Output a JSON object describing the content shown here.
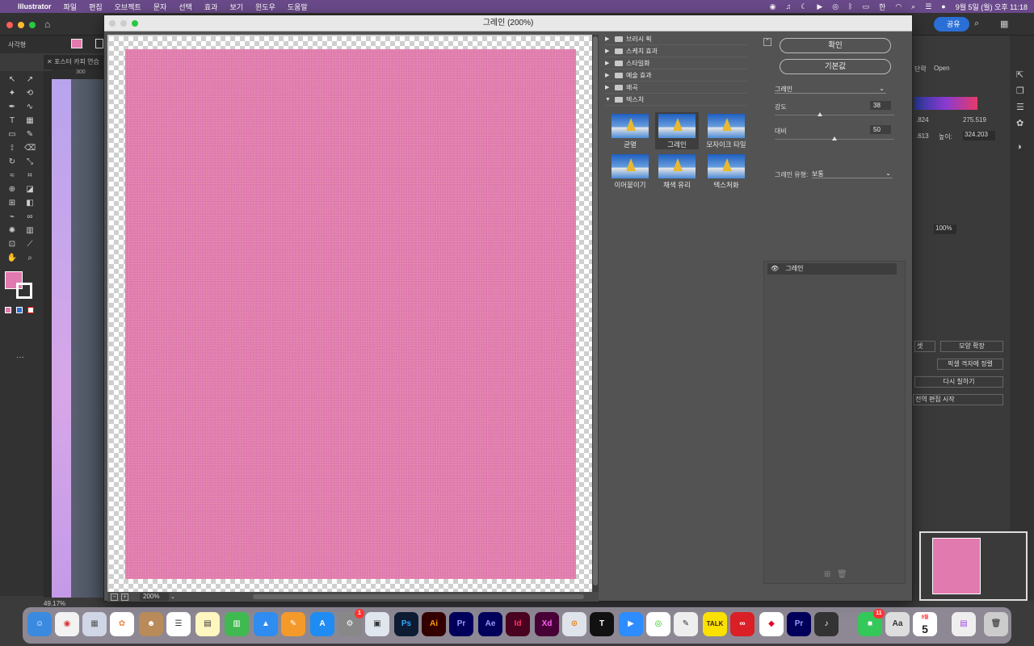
{
  "menubar": {
    "app": "Illustrator",
    "items": [
      "파일",
      "편집",
      "오브젝트",
      "문자",
      "선택",
      "효과",
      "보기",
      "윈도우",
      "도움말"
    ],
    "share": "공유",
    "clock": "9월 5일 (월) 오후 11:18"
  },
  "app": {
    "control_label": "사각형",
    "doc_tab": "포스터 카피 연습",
    "ruler_mark": "300",
    "zoom_status": "49.17%",
    "right_panel": {
      "tab_label_1": "단락",
      "tab_label_2": "Open",
      "w_value": ".824",
      "x_value": "275.519",
      "h_label": "높이:",
      "h_value": "324.203",
      "y_value": ".613",
      "percent": "100%",
      "btn_expand": "모양 확장",
      "btn_pixel": "픽셀 격자에 정렬",
      "btn_redraw": "다시 칠하기",
      "btn_edit": "전역 편집 시작",
      "btn_set": "셋"
    }
  },
  "dialog": {
    "title": "그레인 (200%)",
    "zoom": "200%",
    "categories": [
      {
        "label": "브러시 획",
        "open": false
      },
      {
        "label": "스케치 효과",
        "open": false
      },
      {
        "label": "스타일화",
        "open": false
      },
      {
        "label": "예술 효과",
        "open": false
      },
      {
        "label": "왜곡",
        "open": false
      },
      {
        "label": "텍스처",
        "open": true
      }
    ],
    "thumbnails": [
      "균열",
      "그레인",
      "모자이크 타일",
      "이어붙이기",
      "채색 유리",
      "텍스처화"
    ],
    "selected_thumbnail": "그레인",
    "ok": "확인",
    "default": "기본값",
    "effect_select": "그레인",
    "intensity_label": "강도",
    "intensity_value": "38",
    "intensity_level": 38,
    "contrast_label": "대비",
    "contrast_value": "50",
    "contrast_level": 50,
    "grain_type_label": "그레인 유형:",
    "grain_type_value": "보통",
    "layer_name": "그레인"
  },
  "colors": {
    "art_pink": "#e17aae",
    "menubar": "#6a4a8a",
    "dialog_bg": "#535353"
  },
  "dock": [
    "Finder",
    "Chrome",
    "Launchpad",
    "Photos",
    "Contacts",
    "Reminders",
    "Notes",
    "Numbers",
    "Keynote",
    "Pages",
    "App Store",
    "System Settings",
    "Preview",
    "Ps",
    "Ai",
    "Pr",
    "Ae",
    "Id",
    "Xd",
    "Blender",
    "Typora",
    "Zoom",
    "Naver Whale",
    "Script",
    "KakaoTalk",
    "Creative Cloud",
    "Pinterest",
    "Pr",
    "Rosetta",
    "FaceTime",
    "Dictionary",
    "Calendar",
    "Screenshot",
    "Trash"
  ],
  "dock_badges": {
    "system_settings": "1",
    "facetime": "11"
  },
  "calendar_day": "5",
  "calendar_month": "9월"
}
